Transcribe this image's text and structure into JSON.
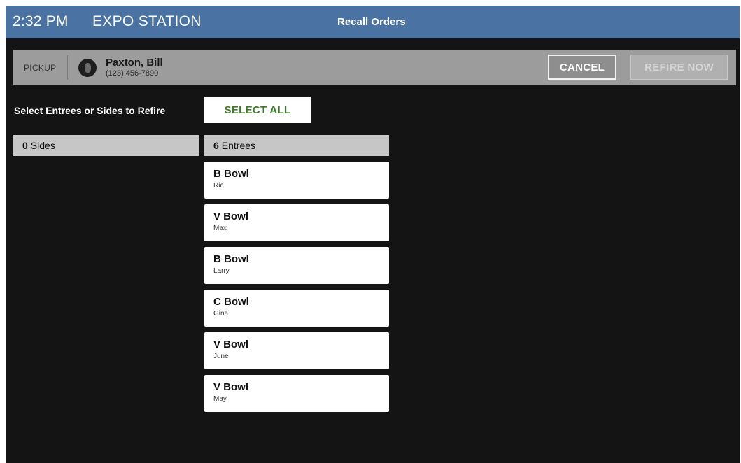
{
  "header": {
    "time": "2:32 PM",
    "station": "EXPO STATION",
    "title": "Recall Orders"
  },
  "customer": {
    "order_type": "PICKUP",
    "avatar_icon": "person-icon",
    "name": "Paxton, Bill",
    "phone": "(123) 456-7890"
  },
  "actions": {
    "cancel_label": "CANCEL",
    "refire_label": "REFIRE NOW"
  },
  "instruction": "Select Entrees or Sides to Refire",
  "select_all_label": "SELECT ALL",
  "sides": {
    "count": "0",
    "label": "Sides"
  },
  "entrees": {
    "count": "6",
    "label": "Entrees",
    "items": [
      {
        "item": "B Bowl",
        "guest": "Ric"
      },
      {
        "item": "V Bowl",
        "guest": "Max"
      },
      {
        "item": "B Bowl",
        "guest": "Larry"
      },
      {
        "item": "C Bowl",
        "guest": "Gina"
      },
      {
        "item": "V Bowl",
        "guest": "June"
      },
      {
        "item": "V Bowl",
        "guest": "May"
      }
    ]
  },
  "colors": {
    "header": "#4a72a2",
    "background": "#141414",
    "select_all_text": "#3d7a2a"
  }
}
